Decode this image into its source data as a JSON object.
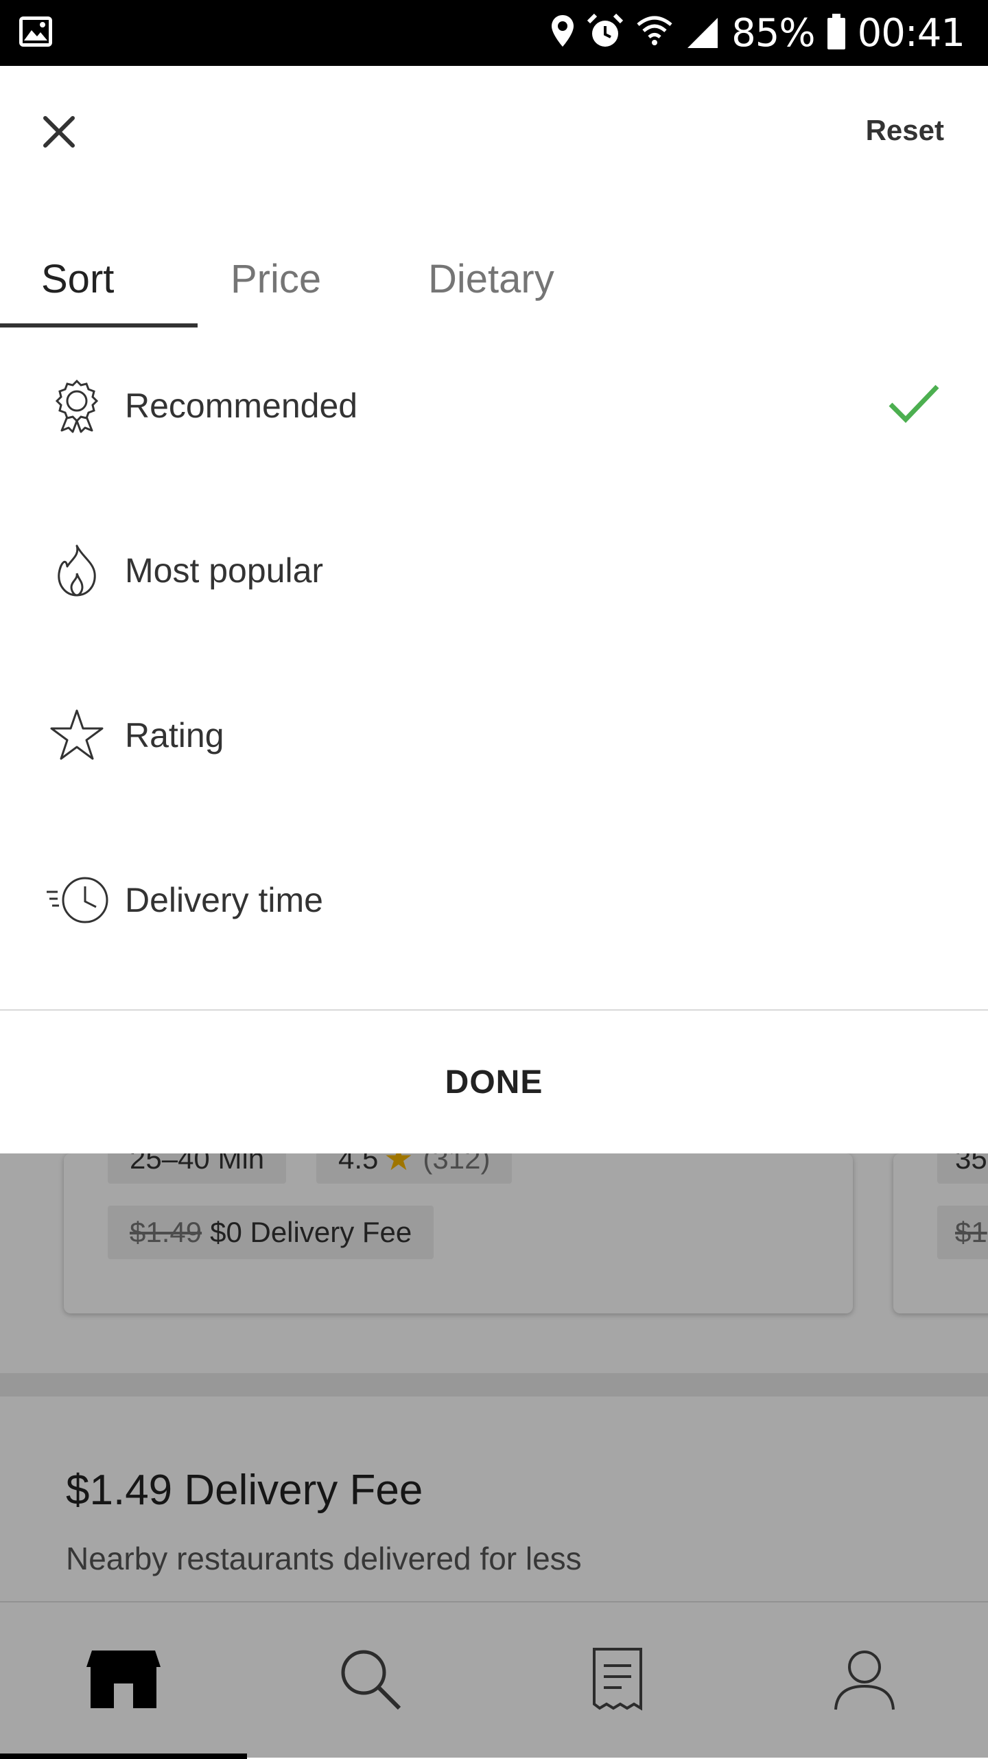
{
  "status_bar": {
    "battery": "85%",
    "time": "00:41"
  },
  "sheet": {
    "reset_label": "Reset",
    "tabs": [
      {
        "label": "Sort",
        "active": true
      },
      {
        "label": "Price",
        "active": false
      },
      {
        "label": "Dietary",
        "active": false
      }
    ],
    "options": [
      {
        "label": "Recommended",
        "icon": "award-ribbon-icon",
        "selected": true
      },
      {
        "label": "Most popular",
        "icon": "flame-icon",
        "selected": false
      },
      {
        "label": "Rating",
        "icon": "star-icon",
        "selected": false
      },
      {
        "label": "Delivery time",
        "icon": "clock-speed-icon",
        "selected": false
      }
    ],
    "done_label": "DONE",
    "check_color": "#4caf50"
  },
  "background": {
    "card1": {
      "time": "25–40 Min",
      "rating": "4.5",
      "rating_count": "(312)",
      "old_fee": "$1.49",
      "fee": "$0 Delivery Fee"
    },
    "card2": {
      "time": "35",
      "old_fee": "$1"
    },
    "section": {
      "title": "$1.49 Delivery Fee",
      "subtitle": "Nearby restaurants delivered for less"
    },
    "nav": [
      {
        "icon": "home-store-icon",
        "active": true
      },
      {
        "icon": "search-icon",
        "active": false
      },
      {
        "icon": "orders-receipt-icon",
        "active": false
      },
      {
        "icon": "account-icon",
        "active": false
      }
    ]
  }
}
